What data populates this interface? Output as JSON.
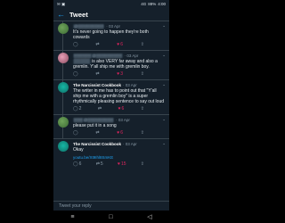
{
  "status_bar": {
    "carrier_icons": "✉ ▣",
    "network_text": "4G",
    "battery_text": "88%",
    "time_text": "4:00"
  },
  "header": {
    "title": "Tweet"
  },
  "tweets": [
    {
      "handle_blurred": "@▒▒▒▒▒▒▒▒▒",
      "time": "· 03 Apr",
      "text": "It's never going to happen they're both cowards",
      "replies": "",
      "retweets": "",
      "likes": "6",
      "avatar": "green"
    },
    {
      "handle_blurred": "▒▒▒▒▒▒ @▒▒▒▒▒▒▒▒▒",
      "time": "· 03 Apr",
      "text_prefix": "▒▒▒▒▒",
      "text": "is also VERY far away and also a gremlin. Y'all ship me with gremlin boy.",
      "replies": "",
      "retweets": "",
      "likes": "3",
      "avatar": "pink"
    },
    {
      "name": "The Narcissist Cookbook",
      "time": "· 03 Apr",
      "text": "The writer in me has to point out that \"Y'all ship me with a gremlin boy\" is a super rhythmically pleasing sentence to say out loud",
      "replies": "2",
      "retweets": "",
      "likes": "6",
      "avatar": "teal"
    },
    {
      "handle_blurred": "▒▒▒ @▒▒▒▒▒▒▒▒▒",
      "time": "· 03 Apr",
      "text": "please put it in a song",
      "replies": "",
      "retweets": "",
      "likes": "6",
      "avatar": "green"
    },
    {
      "name": "The Narcissist Cookbook",
      "time": "· 03 Apr",
      "text": "Okay",
      "link": "youtu.be/Xt9Ihl8SmKE",
      "replies": "6",
      "retweets": "5",
      "likes": "15",
      "avatar": "teal"
    }
  ],
  "reply_placeholder": "Tweet your reply",
  "nav": {
    "menu": "≡",
    "home": "□",
    "back": "◁"
  },
  "icons": {
    "reply": "◯",
    "retweet": "⇄",
    "like": "♡",
    "share": "⇪",
    "more": "⌄"
  }
}
